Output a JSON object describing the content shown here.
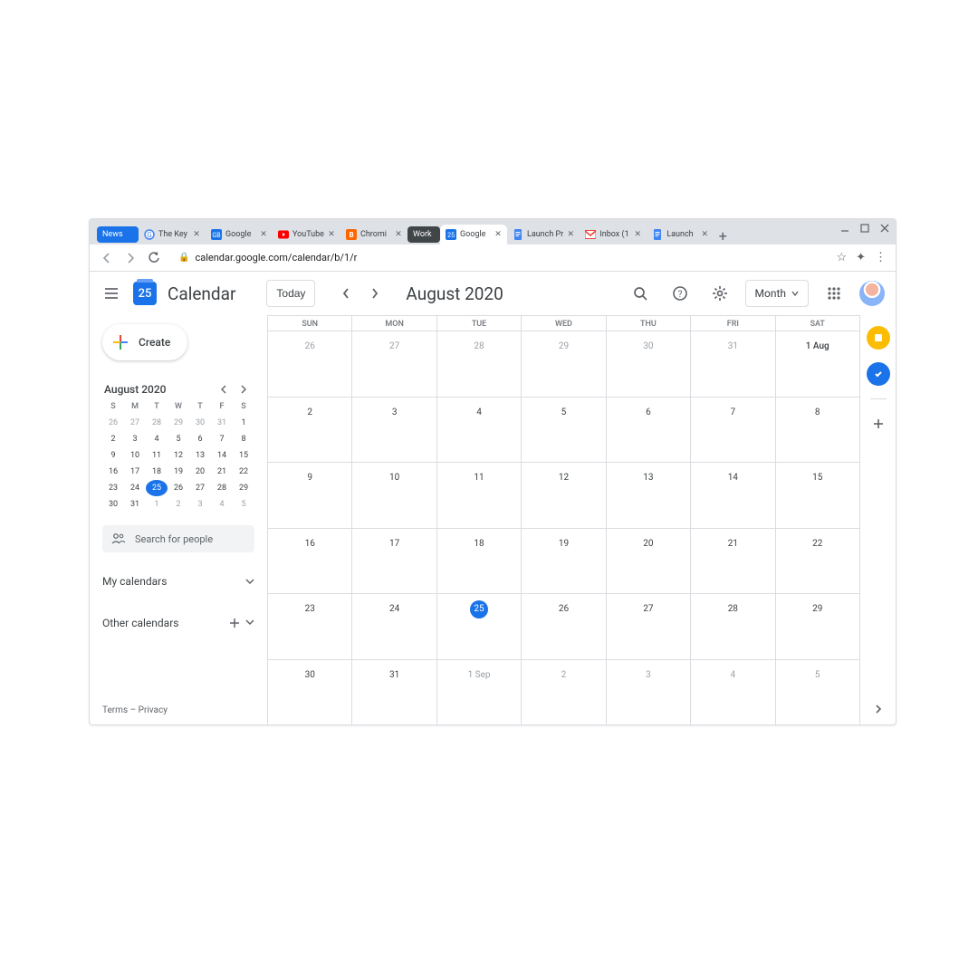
{
  "browser": {
    "tabs": [
      {
        "label": "News",
        "type": "group"
      },
      {
        "label": "The Key",
        "favicon": "g"
      },
      {
        "label": "Google ",
        "favicon": "gb"
      },
      {
        "label": "YouTube",
        "favicon": "yt"
      },
      {
        "label": "Chromi",
        "favicon": "b"
      },
      {
        "label": "Work",
        "type": "group-dark"
      },
      {
        "label": "Google ",
        "favicon": "cal",
        "active": true
      },
      {
        "label": "Launch Pr",
        "favicon": "doc"
      },
      {
        "label": "Inbox (1",
        "favicon": "gm"
      },
      {
        "label": "Launch ",
        "favicon": "doc"
      }
    ],
    "url": "calendar.google.com/calendar/b/1/r"
  },
  "header": {
    "logo_day": "25",
    "app_name": "Calendar",
    "today": "Today",
    "period": "August 2020",
    "view": "Month"
  },
  "sidebar": {
    "create": "Create",
    "mini_title": "August 2020",
    "weekdays": [
      "S",
      "M",
      "T",
      "W",
      "T",
      "F",
      "S"
    ],
    "mini_days": [
      [
        "26",
        "27",
        "28",
        "29",
        "30",
        "31",
        "1"
      ],
      [
        "2",
        "3",
        "4",
        "5",
        "6",
        "7",
        "8"
      ],
      [
        "9",
        "10",
        "11",
        "12",
        "13",
        "14",
        "15"
      ],
      [
        "16",
        "17",
        "18",
        "19",
        "20",
        "21",
        "22"
      ],
      [
        "23",
        "24",
        "25",
        "26",
        "27",
        "28",
        "29"
      ],
      [
        "30",
        "31",
        "1",
        "2",
        "3",
        "4",
        "5"
      ]
    ],
    "mini_muted_rows": {
      "0": [
        0,
        1,
        2,
        3,
        4,
        5
      ],
      "5": [
        2,
        3,
        4,
        5,
        6
      ]
    },
    "mini_today": {
      "row": 4,
      "col": 2
    },
    "search_placeholder": "Search for people",
    "my_calendars": "My calendars",
    "other_calendars": "Other calendars",
    "terms": "Terms",
    "privacy": "Privacy"
  },
  "grid": {
    "weekdays": [
      "SUN",
      "MON",
      "TUE",
      "WED",
      "THU",
      "FRI",
      "SAT"
    ],
    "weeks": [
      [
        {
          "t": "26",
          "m": true
        },
        {
          "t": "27",
          "m": true
        },
        {
          "t": "28",
          "m": true
        },
        {
          "t": "29",
          "m": true
        },
        {
          "t": "30",
          "m": true
        },
        {
          "t": "31",
          "m": true
        },
        {
          "t": "1 Aug",
          "b": true
        }
      ],
      [
        {
          "t": "2"
        },
        {
          "t": "3"
        },
        {
          "t": "4"
        },
        {
          "t": "5"
        },
        {
          "t": "6"
        },
        {
          "t": "7"
        },
        {
          "t": "8"
        }
      ],
      [
        {
          "t": "9"
        },
        {
          "t": "10"
        },
        {
          "t": "11"
        },
        {
          "t": "12"
        },
        {
          "t": "13"
        },
        {
          "t": "14"
        },
        {
          "t": "15"
        }
      ],
      [
        {
          "t": "16"
        },
        {
          "t": "17"
        },
        {
          "t": "18"
        },
        {
          "t": "19"
        },
        {
          "t": "20"
        },
        {
          "t": "21"
        },
        {
          "t": "22"
        }
      ],
      [
        {
          "t": "23"
        },
        {
          "t": "24"
        },
        {
          "t": "25",
          "today": true
        },
        {
          "t": "26"
        },
        {
          "t": "27"
        },
        {
          "t": "28"
        },
        {
          "t": "29"
        }
      ],
      [
        {
          "t": "30"
        },
        {
          "t": "31"
        },
        {
          "t": "1 Sep",
          "m": true
        },
        {
          "t": "2",
          "m": true
        },
        {
          "t": "3",
          "m": true
        },
        {
          "t": "4",
          "m": true
        },
        {
          "t": "5",
          "m": true
        }
      ]
    ]
  }
}
